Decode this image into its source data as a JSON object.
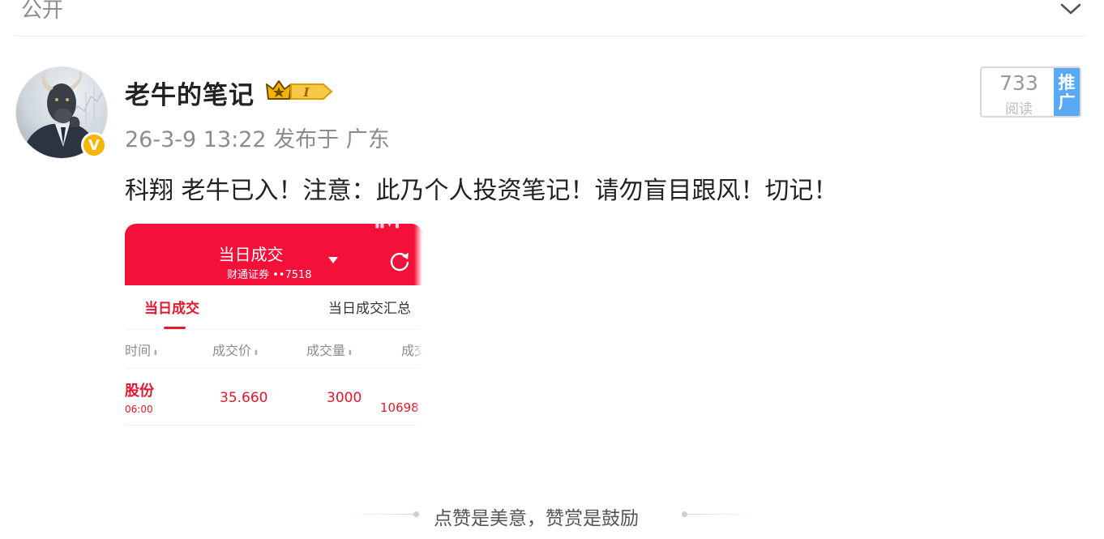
{
  "header": {
    "visibility_label": "公开",
    "expand_icon": "chevron-down-icon"
  },
  "author": {
    "name": "老牛的笔记",
    "verified_badge": "V",
    "member_badge_icon": "crown-level-icon",
    "member_level": "I"
  },
  "post": {
    "meta": "26-3-9 13:22 发布于 广东",
    "text": "科翔 老牛已入！注意：此乃个人投资笔记！请勿盲目跟风！切记！"
  },
  "stats": {
    "read_count": "733",
    "read_label": "阅读",
    "promote_label_1": "推",
    "promote_label_2": "广"
  },
  "attachment": {
    "title": "当日成交",
    "account": "财通证券 ••7518",
    "tab_active": "当日成交",
    "tab_other": "当日成交汇总",
    "columns": [
      "时间",
      "成交价",
      "成交量",
      "成交"
    ],
    "row": {
      "name": "股份",
      "time": "06:00",
      "price": "35.660",
      "volume": "3000",
      "amount": "10698"
    }
  },
  "footer": {
    "text": "点赞是美意，赞赏是鼓励"
  },
  "colors": {
    "accent_red": "#f5103a",
    "promote_blue": "#5aa9f5",
    "verified_yellow": "#f7b500"
  }
}
